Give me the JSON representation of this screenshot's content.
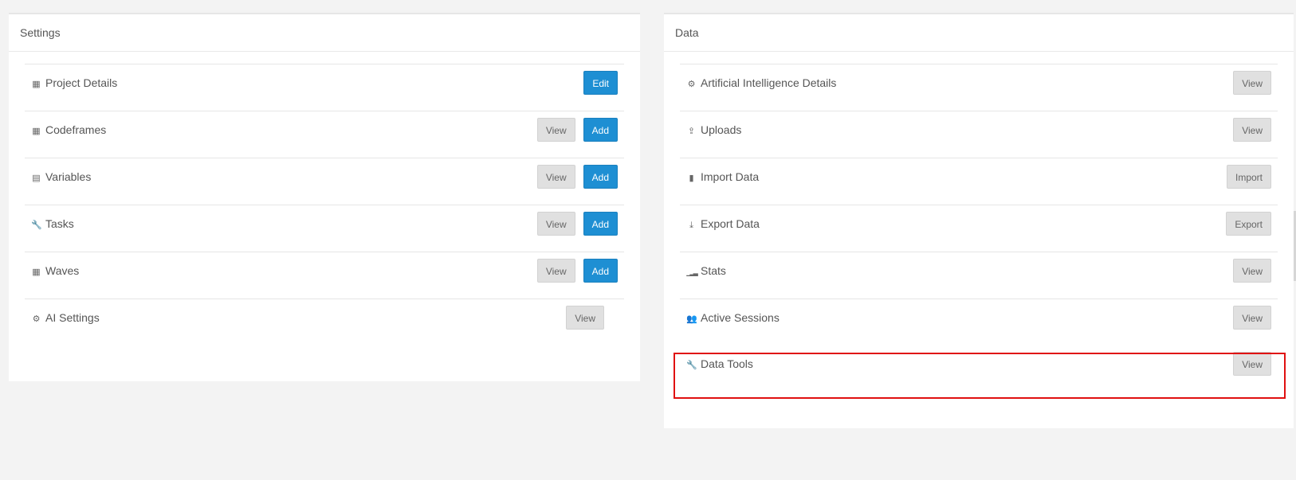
{
  "settings": {
    "title": "Settings",
    "rows": [
      {
        "label": "Project Details",
        "icon": "table-icon",
        "glyph": "▦",
        "buttons": [
          "Edit"
        ]
      },
      {
        "label": "Codeframes",
        "icon": "table-icon",
        "glyph": "▦",
        "buttons": [
          "View",
          "Add"
        ]
      },
      {
        "label": "Variables",
        "icon": "calculator-icon",
        "glyph": "▤",
        "buttons": [
          "View",
          "Add"
        ]
      },
      {
        "label": "Tasks",
        "icon": "wrench-icon",
        "glyph": "🔧",
        "buttons": [
          "View",
          "Add"
        ]
      },
      {
        "label": "Waves",
        "icon": "calendar-icon",
        "glyph": "▦",
        "buttons": [
          "View",
          "Add"
        ]
      },
      {
        "label": "AI Settings",
        "icon": "gears-icon",
        "glyph": "⚙",
        "buttons": [
          "View"
        ]
      }
    ]
  },
  "data": {
    "title": "Data",
    "rows": [
      {
        "label": "Artificial Intelligence Details",
        "icon": "gears-icon",
        "glyph": "⚙",
        "button": "View"
      },
      {
        "label": "Uploads",
        "icon": "upload-icon",
        "glyph": "⇪",
        "button": "View"
      },
      {
        "label": "Import Data",
        "icon": "file-icon",
        "glyph": "▮",
        "button": "Import"
      },
      {
        "label": "Export Data",
        "icon": "download-icon",
        "glyph": "⤓",
        "button": "Export"
      },
      {
        "label": "Stats",
        "icon": "signal-icon",
        "glyph": "▁▂▃",
        "button": "View"
      },
      {
        "label": "Active Sessions",
        "icon": "users-icon",
        "glyph": "👥",
        "button": "View"
      },
      {
        "label": "Data Tools",
        "icon": "wrench-icon",
        "glyph": "🔧",
        "button": "View"
      }
    ]
  },
  "colors": {
    "primary": "#1e8fd3",
    "default_button": "#e0e0e0",
    "highlight": "#e01010",
    "background": "#f3f3f3"
  }
}
